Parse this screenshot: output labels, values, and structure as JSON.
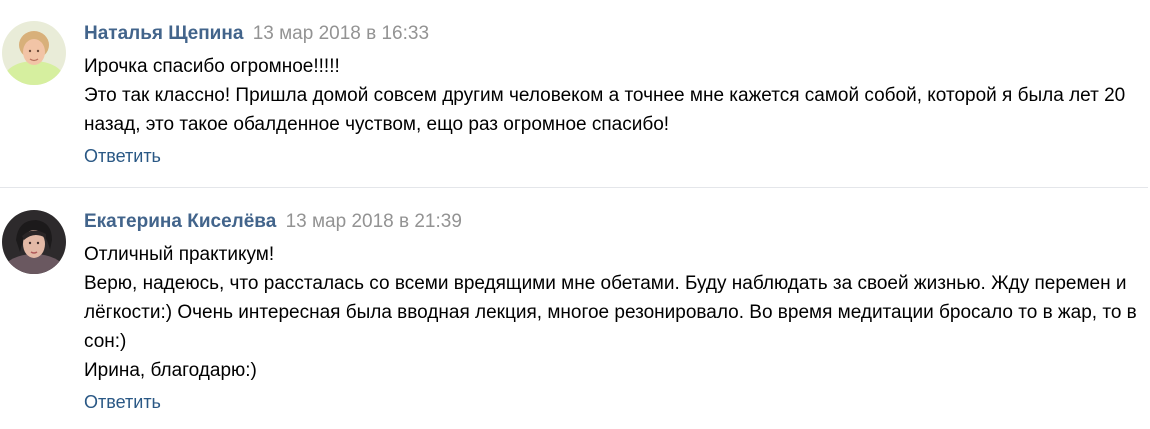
{
  "comments": [
    {
      "author": "Наталья Щепина",
      "date": "13 мар 2018 в 16:33",
      "lines": [
        "Ирочка спасибо огромное!!!!!",
        "Это так классно! Пришла домой совсем другим человеком а точнее мне кажется самой собой, которой я была лет 20 назад, это такое обалденное чуством, ещо раз огромное спасибо!"
      ],
      "reply_label": "Ответить"
    },
    {
      "author": "Екатерина Киселёва",
      "date": "13 мар 2018 в 21:39",
      "lines": [
        "Отличный практикум!",
        "Верю, надеюсь, что рассталась со всеми вредящими мне обетами. Буду наблюдать за своей жизнью. Жду перемен и лёгкости:) Очень интересная была вводная лекция, многое резонировало. Во время медитации бросало то в жар, то в сон:)",
        "Ирина, благодарю:)"
      ],
      "reply_label": "Ответить"
    }
  ],
  "colors": {
    "author": "#42648b",
    "date": "#939393",
    "reply": "#2a5885",
    "divider": "#e4e6ea"
  }
}
